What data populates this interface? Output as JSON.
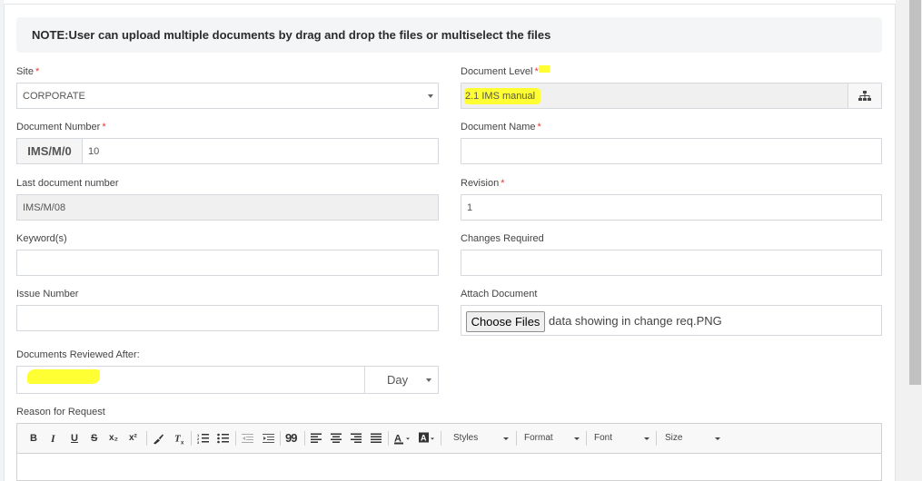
{
  "note": {
    "text": "NOTE:User can upload multiple documents by drag and drop the files or multiselect the files"
  },
  "form": {
    "site": {
      "label": "Site",
      "required_mark": "*",
      "value": "CORPORATE"
    },
    "document_level": {
      "label": "Document Level",
      "required_mark": "*",
      "value": "2.1 IMS manual"
    },
    "document_number": {
      "label": "Document Number",
      "required_mark": "*",
      "prefix": "IMS/M/0",
      "value": "10"
    },
    "document_name": {
      "label": "Document Name",
      "required_mark": "*",
      "value": ""
    },
    "last_document_number": {
      "label": "Last document number",
      "value": "IMS/M/08"
    },
    "revision": {
      "label": "Revision",
      "required_mark": "*",
      "value": "1"
    },
    "keywords": {
      "label": "Keyword(s)",
      "value": ""
    },
    "changes_required": {
      "label": "Changes Required",
      "value": ""
    },
    "issue_number": {
      "label": "Issue Number",
      "value": ""
    },
    "attach_document": {
      "label": "Attach Document",
      "button_label": "Choose Files",
      "file_name": "data showing in change req.PNG"
    },
    "documents_reviewed_after": {
      "label": "Documents Reviewed After:",
      "value": "",
      "unit": "Day"
    },
    "reason_for_request": {
      "label": "Reason for Request"
    }
  },
  "editor_toolbar": {
    "bold": "B",
    "italic": "I",
    "underline": "U",
    "strike": "S",
    "subscript": "x₂",
    "superscript": "x²",
    "blockquote": "99",
    "styles_label": "Styles",
    "format_label": "Format",
    "font_label": "Font",
    "size_label": "Size"
  },
  "colors": {
    "highlight": "#ffff33",
    "required": "#e53935"
  }
}
